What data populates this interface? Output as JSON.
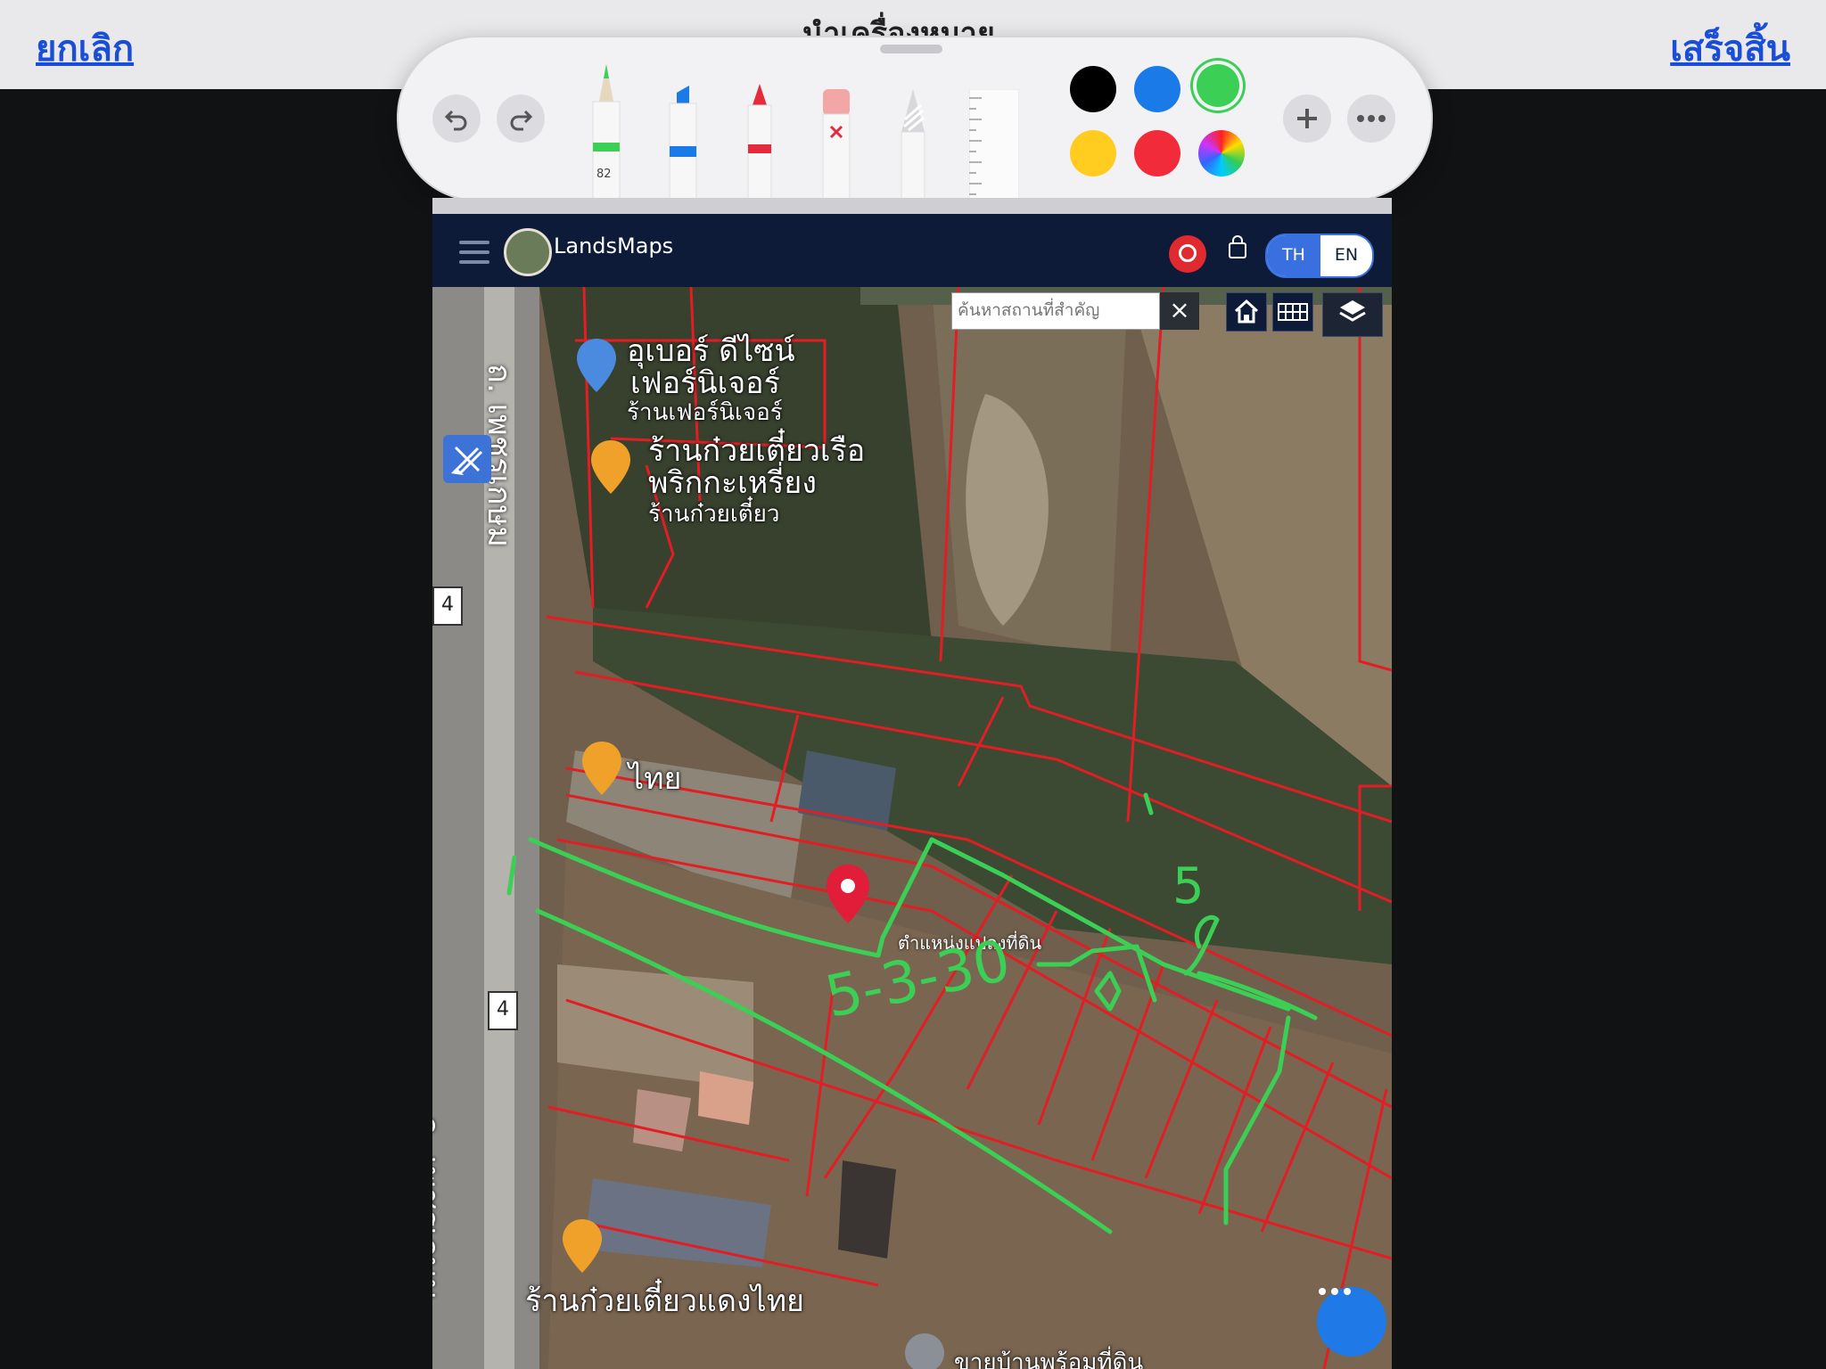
{
  "topbar": {
    "cancel_label": "ยกเลิก",
    "done_label": "เสร็จสิ้น",
    "title": "นำเครื่องหมาย"
  },
  "palette": {
    "pen_size": "82",
    "colors": [
      "#000000",
      "#1a7ae8",
      "#3bcf55",
      "#ffcc1f",
      "#f22b3a"
    ],
    "selected_color": "#3bcf55"
  },
  "app": {
    "brand": "LandsMaps",
    "lang_th": "TH",
    "lang_en": "EN"
  },
  "map": {
    "search_placeholder": "ค้นหาสถานที่สำคัญ",
    "clear_label": "×",
    "road_name": "ถ. เพชรเกษม",
    "road_name_bottom": "ถ. เพชรเกษม",
    "highway_number": "4",
    "highway_number_2": "4",
    "places": [
      {
        "name": "อุเบอร์ ดีไซน์"
      },
      {
        "name": "เฟอร์นิเจอร์"
      },
      {
        "name": "ร้านเฟอร์นิเจอร์"
      },
      {
        "name": "ร้านก๋วยเตี๋ยวเรือ"
      },
      {
        "name": "พริกกะเหรี่ยง"
      },
      {
        "name": "ร้านก๋วยเตี๋ยว"
      },
      {
        "name": "ไทย"
      },
      {
        "name": "ร้านก๋วยเตี๋ยวแดงไทย"
      },
      {
        "name": "ขายบ้านพร้อมที่ดิน"
      }
    ],
    "parcel_pin_label": "ตำแหน่งแปลงที่ดิน",
    "annotation_text": "5-3-30",
    "annotation_side": "5"
  }
}
